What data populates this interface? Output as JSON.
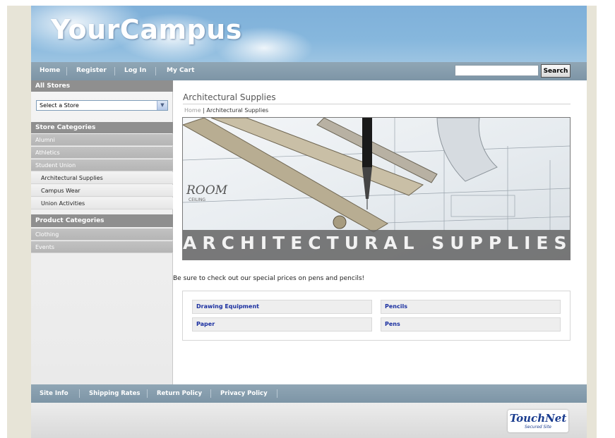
{
  "header": {
    "logo_text": "YourCampus"
  },
  "top_nav": {
    "links": [
      "Home",
      "Register",
      "Log In",
      "My Cart"
    ],
    "search_value": "",
    "search_button": "Search"
  },
  "sidebar": {
    "all_stores_heading": "All Stores",
    "store_select_value": "Select a Store",
    "store_categories_heading": "Store Categories",
    "store_categories": [
      {
        "label": "Alumni",
        "sub": false
      },
      {
        "label": "Athletics",
        "sub": false
      },
      {
        "label": "Student Union",
        "sub": false
      },
      {
        "label": "Architectural Supplies",
        "sub": true
      },
      {
        "label": "Campus Wear",
        "sub": true
      },
      {
        "label": "Union Activities",
        "sub": true
      }
    ],
    "product_categories_heading": "Product Categories",
    "product_categories": [
      "Clothing",
      "Events"
    ]
  },
  "main": {
    "title": "Architectural Supplies",
    "breadcrumb_home": "Home",
    "breadcrumb_sep": "|",
    "breadcrumb_current": "Architectural Supplies",
    "banner_text": "ARCHITECTURAL SUPPLIES",
    "banner_room_text": "ROOM",
    "banner_ceiling_text": "CEILING",
    "promo_text": "Be sure to check out our special prices on pens and pencils!",
    "subcategories": [
      "Drawing Equipment",
      "Pencils",
      "Paper",
      "Pens"
    ]
  },
  "footer": {
    "links": [
      "Site Info",
      "Shipping Rates",
      "Return Policy",
      "Privacy Policy"
    ],
    "badge_name": "TouchNet",
    "badge_sub": "Secured Site"
  }
}
